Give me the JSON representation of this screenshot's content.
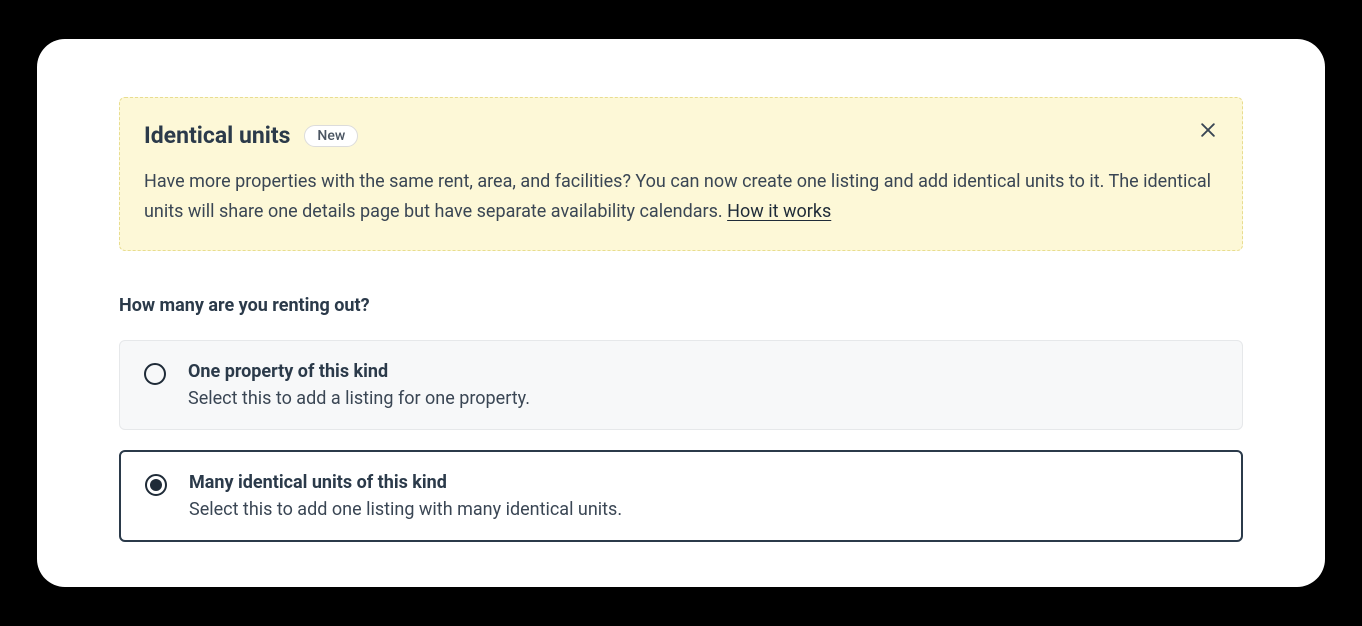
{
  "notice": {
    "title": "Identical units",
    "badge": "New",
    "body": "Have more properties with the same rent, area, and facilities? You can now create one listing and add identical units to it. The identical units will share one details page but have separate availability calendars. ",
    "link": "How it works"
  },
  "question": "How many are you renting out?",
  "options": {
    "one": {
      "title": "One property of this kind",
      "desc": "Select this to add a listing for one property."
    },
    "many": {
      "title": "Many identical units of this kind",
      "desc": "Select this to add one listing with many identical units."
    }
  }
}
